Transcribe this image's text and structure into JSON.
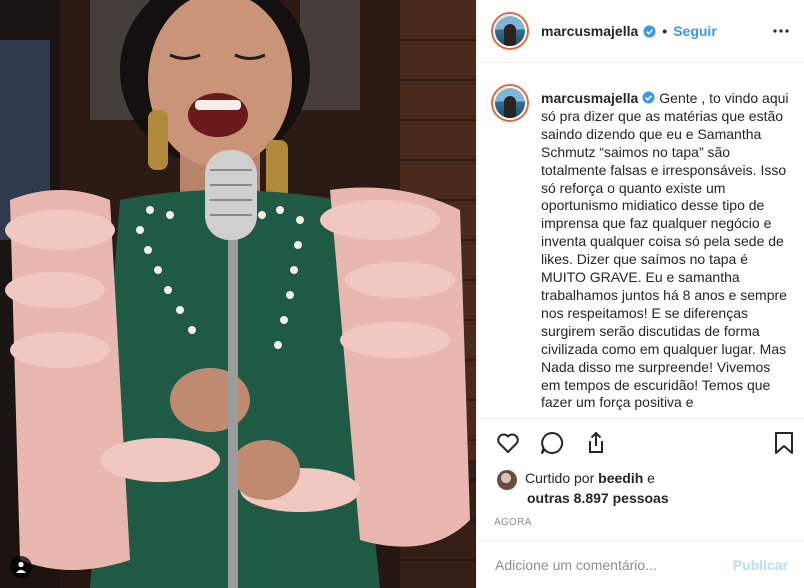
{
  "post": {
    "username": "marcusmajella",
    "follow_label": "Seguir",
    "separator": "•",
    "caption": "Gente , to vindo aqui só pra dizer que as matérias que estão saindo dizendo que eu e Samantha Schmutz “saimos no tapa” são totalmente falsas e irresponsáveis. Isso só reforça o quanto existe um oportunismo midiatico desse tipo de imprensa que faz qualquer negócio e inventa qualquer coisa só pela sede de likes. Dizer que saímos no tapa é MUITO GRAVE. Eu e samantha trabalhamos juntos há 8 anos e sempre nos respeitamos! E se diferenças surgirem serão discutidas de forma civilizada como em qualquer lugar. Mas Nada disso me surpreende! Vivemos em tempos de escuridão! Temos que fazer um força positiva e",
    "liked_by_prefix": "Curtido por",
    "liked_by_user": "beedih",
    "liked_by_conj": "e",
    "liked_others": "outras 8.897 pessoas",
    "timestamp": "AGORA"
  },
  "comment": {
    "placeholder": "Adicione um comentário...",
    "publish_label": "Publicar"
  },
  "icons": {
    "verified": "verified-badge-icon",
    "more": "more-options-icon",
    "like": "heart-icon",
    "comment": "comment-icon",
    "share": "share-icon",
    "save": "bookmark-icon",
    "tag": "user-tag-icon"
  },
  "colors": {
    "accent": "#3897f0",
    "publish_disabled": "#b2dffc",
    "muted": "#8e8e8e",
    "border": "#efefef"
  }
}
